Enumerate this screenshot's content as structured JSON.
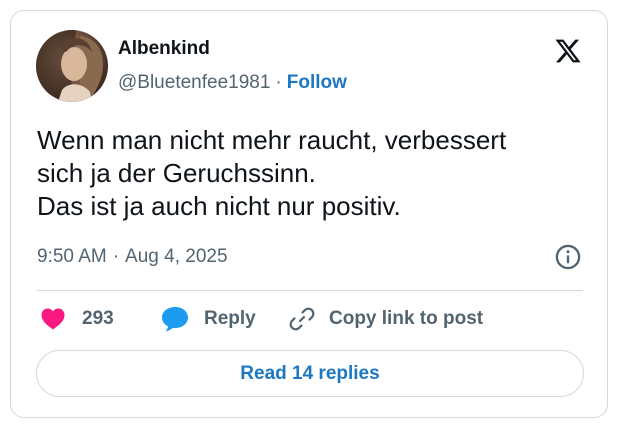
{
  "author": {
    "display_name": "Albenkind",
    "handle": "@Bluetenfee1981",
    "separator": "·",
    "follow_label": "Follow"
  },
  "tweet": {
    "lines": [
      "Wenn man nicht mehr raucht, verbessert",
      "sich ja der Geruchssinn.",
      "Das ist ja auch nicht nur positiv."
    ],
    "time": "9:50 AM",
    "separator": "·",
    "date": "Aug 4, 2025"
  },
  "actions": {
    "like_count": "293",
    "reply_label": "Reply",
    "copy_label": "Copy link to post"
  },
  "read_replies_label": "Read 14 replies",
  "icons": {
    "brand": "x-logo-icon",
    "info": "info-icon",
    "like": "heart-icon",
    "reply": "speech-bubble-icon",
    "copy": "link-icon"
  },
  "colors": {
    "heart": "#f91880",
    "reply_bubble": "#1d9bf0",
    "link_blue": "#1d77c3",
    "text_primary": "#0f1419",
    "text_secondary": "#536471",
    "border": "#cfd9de"
  }
}
